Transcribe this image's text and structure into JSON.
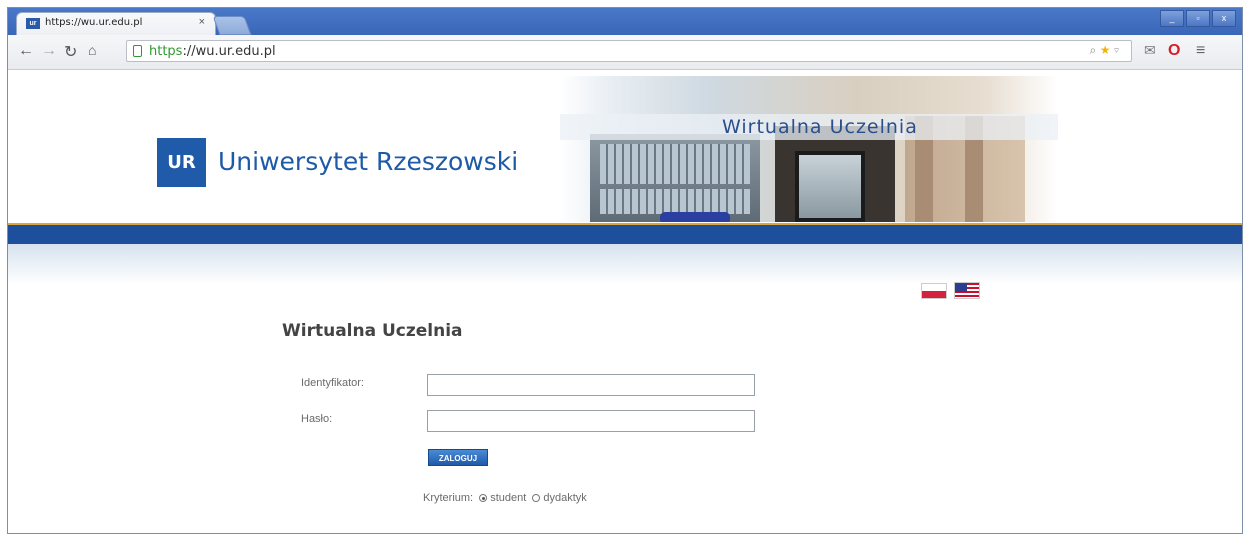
{
  "browser": {
    "tab_title": "https://wu.ur.edu.pl",
    "tab_close": "×",
    "url_scheme": "https",
    "url_rest": "://wu.ur.edu.pl",
    "window_buttons": [
      "_",
      "▫",
      "x"
    ]
  },
  "header": {
    "logo_text": "UR",
    "university_name": "Uniwersytet Rzeszowski",
    "banner_title": "Wirtualna Uczelnia"
  },
  "languages": [
    "Polski",
    "English"
  ],
  "form": {
    "title": "Wirtualna Uczelnia",
    "id_label": "Identyfikator:",
    "password_label": "Hasło:",
    "id_value": "",
    "password_value": "",
    "login_button": "ZALOGUJ",
    "criterion_label": "Kryterium:",
    "options": [
      {
        "label": "student",
        "selected": true
      },
      {
        "label": "dydaktyk",
        "selected": false
      }
    ]
  },
  "colors": {
    "brand_blue": "#1d4f9c",
    "accent_gold": "#d9a640"
  }
}
